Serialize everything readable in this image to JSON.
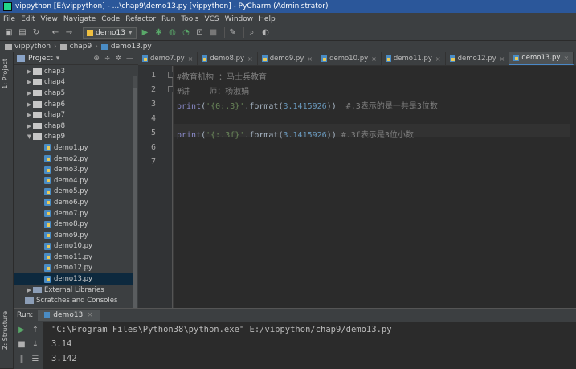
{
  "window": {
    "title": "vippython [E:\\vippython] - ...\\chap9\\demo13.py [vippython] - PyCharm (Administrator)"
  },
  "menu": [
    "File",
    "Edit",
    "View",
    "Navigate",
    "Code",
    "Refactor",
    "Run",
    "Tools",
    "VCS",
    "Window",
    "Help"
  ],
  "toolbar": {
    "run_config": "demo13"
  },
  "breadcrumb": [
    "vippython",
    "chap9",
    "demo13.py"
  ],
  "left_tabs": {
    "project": "1: Project",
    "structure": "Z: Structure"
  },
  "project": {
    "header": "Project",
    "tree": [
      {
        "label": "chap3",
        "kind": "folder",
        "expand": "▶"
      },
      {
        "label": "chap4",
        "kind": "folder",
        "expand": "▶"
      },
      {
        "label": "chap5",
        "kind": "folder",
        "expand": "▶"
      },
      {
        "label": "chap6",
        "kind": "folder",
        "expand": "▶"
      },
      {
        "label": "chap7",
        "kind": "folder",
        "expand": "▶"
      },
      {
        "label": "chap8",
        "kind": "folder",
        "expand": "▶"
      },
      {
        "label": "chap9",
        "kind": "folder",
        "expand": "▼"
      },
      {
        "label": "demo1.py",
        "kind": "py"
      },
      {
        "label": "demo2.py",
        "kind": "py"
      },
      {
        "label": "demo3.py",
        "kind": "py"
      },
      {
        "label": "demo4.py",
        "kind": "py"
      },
      {
        "label": "demo5.py",
        "kind": "py"
      },
      {
        "label": "demo6.py",
        "kind": "py"
      },
      {
        "label": "demo7.py",
        "kind": "py"
      },
      {
        "label": "demo8.py",
        "kind": "py"
      },
      {
        "label": "demo9.py",
        "kind": "py"
      },
      {
        "label": "demo10.py",
        "kind": "py"
      },
      {
        "label": "demo11.py",
        "kind": "py"
      },
      {
        "label": "demo12.py",
        "kind": "py"
      },
      {
        "label": "demo13.py",
        "kind": "py",
        "selected": true
      },
      {
        "label": "External Libraries",
        "kind": "lib",
        "expand": "▶"
      },
      {
        "label": "Scratches and Consoles",
        "kind": "scratch"
      }
    ]
  },
  "tabs": [
    "demo7.py",
    "demo8.py",
    "demo9.py",
    "demo10.py",
    "demo11.py",
    "demo12.py",
    "demo13.py"
  ],
  "active_tab": "demo13.py",
  "editor": {
    "line_numbers": [
      "1",
      "2",
      "3",
      "4",
      "5",
      "6",
      "7"
    ],
    "line1": "#教育机构 ：马士兵教育",
    "line2": "#讲    师：杨淑娟",
    "line3": {
      "fn": "print",
      "open": "(",
      "str": "'{0:.3}'",
      "dot": ".format(",
      "num": "3.1415926",
      "close": "))",
      "cmt": "  #.3表示的是一共是3位数"
    },
    "line5": {
      "fn": "print",
      "open": "(",
      "str": "'{:.3f}'",
      "dot": ".format(",
      "num": "3.1415926",
      "close": "))",
      "cmt": " #.3f表示是3位小数"
    }
  },
  "run": {
    "label": "Run:",
    "tab": "demo13",
    "output": [
      "\"C:\\Program Files\\Python38\\python.exe\" E:/vippython/chap9/demo13.py",
      "3.14",
      "3.142"
    ]
  }
}
